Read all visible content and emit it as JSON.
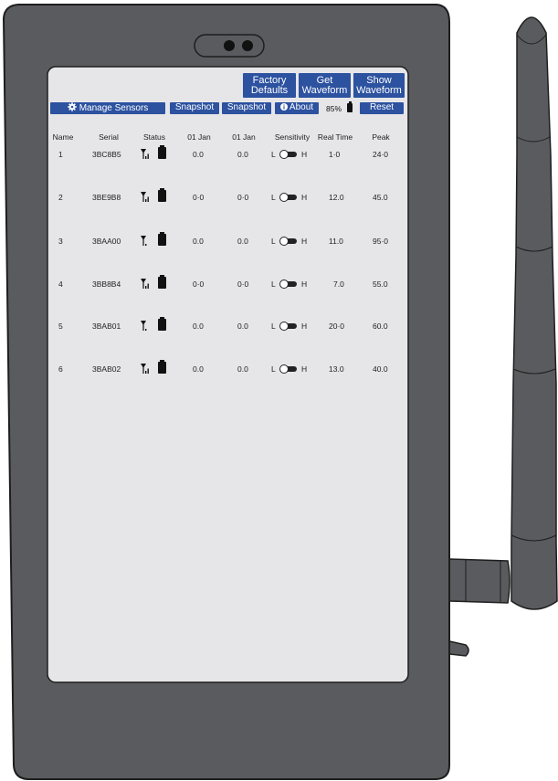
{
  "toolbar": {
    "factory_defaults_line1": "Factory",
    "factory_defaults_line2": "Defaults",
    "get_waveform_line1": "Get",
    "get_waveform_line2": "Waveform",
    "show_waveform_line1": "Show",
    "show_waveform_line2": "Waveform",
    "manage_sensors": "Manage Sensors",
    "snapshot_1": "Snapshot",
    "snapshot_2": "Snapshot",
    "about": "About",
    "battery_percent": "85%",
    "reset": "Reset"
  },
  "table": {
    "headers": [
      "Name",
      "Serial",
      "Status",
      "01 Jan",
      "01 Jan",
      "Sensitivity",
      "Real Time",
      "Peak"
    ],
    "sensitivity_low": "L",
    "sensitivity_high": "H",
    "rows": [
      {
        "name": "1",
        "serial": "3BC8B5",
        "jan1": "0.0",
        "jan2": "0.0",
        "realtime": "1·0",
        "peak": "24·0"
      },
      {
        "name": "2",
        "serial": "3BE9B8",
        "jan1": "0·0",
        "jan2": "0·0",
        "realtime": "12.0",
        "peak": "45.0"
      },
      {
        "name": "3",
        "serial": "3BAA00",
        "jan1": "0.0",
        "jan2": "0.0",
        "realtime": "11.0",
        "peak": "95·0"
      },
      {
        "name": "4",
        "serial": "3BB8B4",
        "jan1": "0·0",
        "jan2": "0·0",
        "realtime": "7.0",
        "peak": "55.0"
      },
      {
        "name": "5",
        "serial": "3BAB01",
        "jan1": "0.0",
        "jan2": "0.0",
        "realtime": "20·0",
        "peak": "60.0"
      },
      {
        "name": "6",
        "serial": "3BAB02",
        "jan1": "0.0",
        "jan2": "0.0",
        "realtime": "13.0",
        "peak": "40.0"
      }
    ]
  },
  "colors": {
    "accent": "#2c52a0",
    "device_body": "#5a5b5e",
    "screen": "#e6e6e9"
  },
  "icons": [
    "gear-icon",
    "info-icon",
    "battery-icon",
    "signal-antenna-icon",
    "toggle-icon"
  ]
}
